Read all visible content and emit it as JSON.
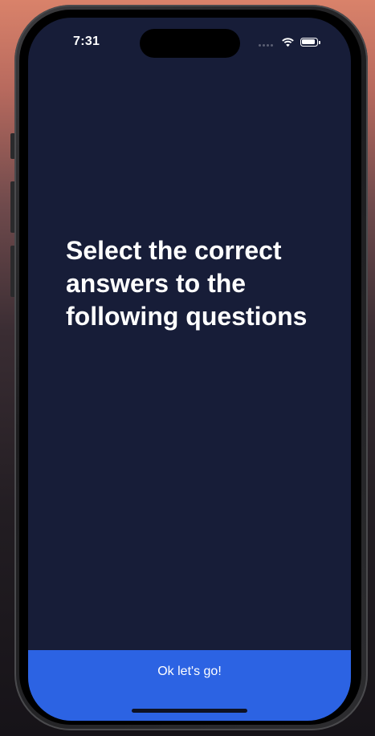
{
  "status_bar": {
    "time": "7:31",
    "signal_icon": "cellular-dots-icon",
    "wifi_icon": "wifi-icon",
    "battery_icon": "battery-icon"
  },
  "main": {
    "heading": "Select the correct answers to the following questions"
  },
  "footer": {
    "button_label": "Ok let's go!"
  },
  "colors": {
    "screen_background": "#171d38",
    "button_background": "#2c63e3",
    "text": "#ffffff"
  }
}
